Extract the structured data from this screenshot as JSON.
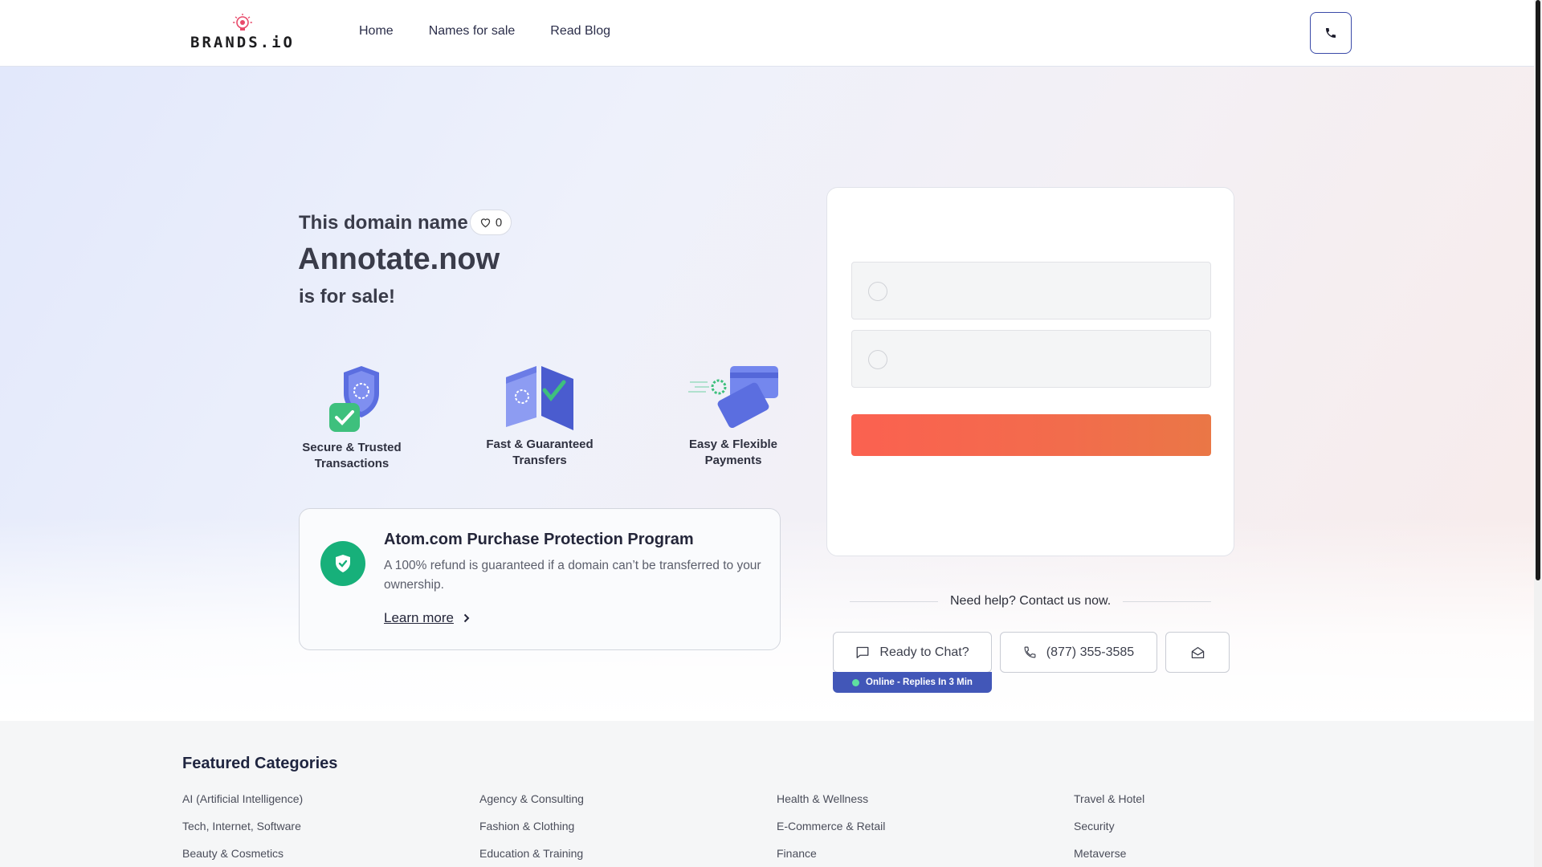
{
  "header": {
    "logo_text": "BRANDS.iO",
    "nav": [
      "Home",
      "Names for sale",
      "Read Blog"
    ]
  },
  "hero": {
    "title_line1": "This domain name",
    "like_count": "0",
    "domain": "Annotate.now",
    "title_line3": "is for sale!"
  },
  "features": [
    {
      "line1": "Secure & Trusted",
      "line2": "Transactions"
    },
    {
      "line1": "Fast & Guaranteed",
      "line2": "Transfers"
    },
    {
      "line1": "Easy & Flexible",
      "line2": "Payments"
    }
  ],
  "protection": {
    "title": "Atom.com Purchase Protection Program",
    "text": "A 100% refund is guaranteed if a domain can’t be transferred to your ownership.",
    "link": "Learn more"
  },
  "help": {
    "heading": "Need help? Contact us now.",
    "chat_label": "Ready to Chat?",
    "phone_label": "(877) 355-3585",
    "online_status": "Online - Replies In 3 Min"
  },
  "categories": {
    "title": "Featured Categories",
    "columns": [
      [
        "AI (Artificial Intelligence)",
        "Tech, Internet, Software",
        "Beauty & Cosmetics"
      ],
      [
        "Agency & Consulting",
        "Fashion & Clothing",
        "Education & Training"
      ],
      [
        "Health & Wellness",
        "E-Commerce & Retail",
        "Finance"
      ],
      [
        "Travel & Hotel",
        "Security",
        "Metaverse"
      ]
    ]
  },
  "colors": {
    "accent": "#4257b8",
    "cta_start": "#fb6150",
    "cta_end": "#ea7746",
    "success": "#17b07a"
  }
}
